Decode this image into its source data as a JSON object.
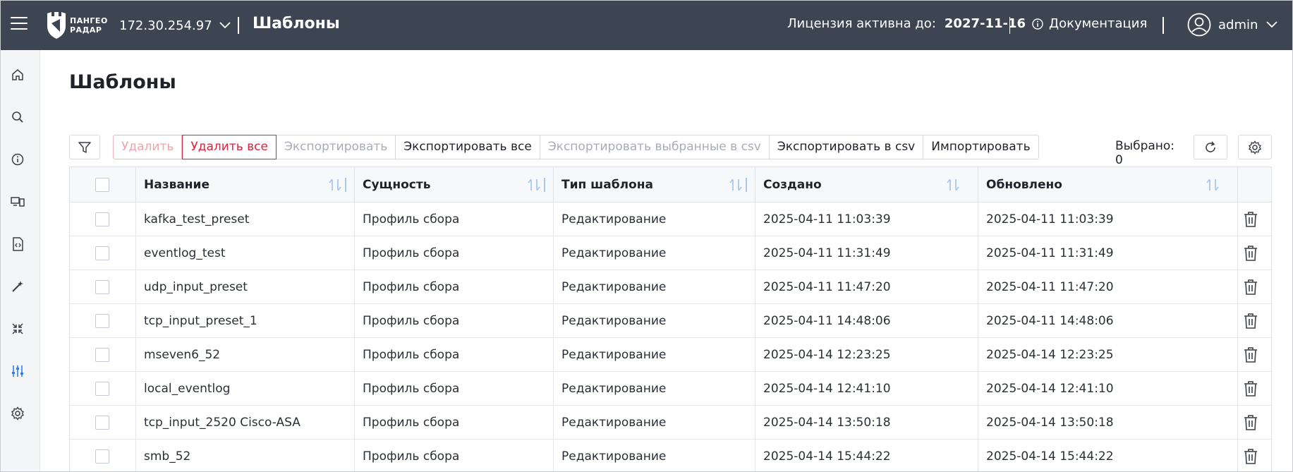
{
  "header": {
    "logo_line1": "ПАНГЕО",
    "logo_line2": "РАДАР",
    "server_ip": "172.30.254.97",
    "title": "Шаблоны",
    "license_label": "Лицензия активна до:",
    "license_date": "2027-11-16",
    "docs_label": "Документация",
    "username": "admin"
  },
  "sidebar": {
    "items": [
      {
        "icon": "home-icon"
      },
      {
        "icon": "search-icon"
      },
      {
        "icon": "info-icon"
      },
      {
        "icon": "devices-icon"
      },
      {
        "icon": "code-file-icon"
      },
      {
        "icon": "magic-wand-icon"
      },
      {
        "icon": "collapse-icon"
      },
      {
        "icon": "sliders-icon",
        "active": true
      },
      {
        "icon": "gear-icon"
      }
    ],
    "active_color": "#2f80ed"
  },
  "page": {
    "title": "Шаблоны"
  },
  "toolbar": {
    "delete": "Удалить",
    "delete_all": "Удалить все",
    "export": "Экспортировать",
    "export_all": "Экспортировать все",
    "export_selected_csv": "Экспортировать выбранные в csv",
    "export_csv": "Экспортировать в csv",
    "import": "Импортировать",
    "selected": "Выбрано: 0"
  },
  "table": {
    "columns": [
      "Название",
      "Сущность",
      "Тип шаблона",
      "Создано",
      "Обновлено"
    ],
    "rows": [
      {
        "name": "kafka_test_preset",
        "entity": "Профиль сбора",
        "type": "Редактирование",
        "created": "2025-04-11 11:03:39",
        "updated": "2025-04-11 11:03:39"
      },
      {
        "name": "eventlog_test",
        "entity": "Профиль сбора",
        "type": "Редактирование",
        "created": "2025-04-11 11:31:49",
        "updated": "2025-04-11 11:31:49"
      },
      {
        "name": "udp_input_preset",
        "entity": "Профиль сбора",
        "type": "Редактирование",
        "created": "2025-04-11 11:47:20",
        "updated": "2025-04-11 11:47:20"
      },
      {
        "name": "tcp_input_preset_1",
        "entity": "Профиль сбора",
        "type": "Редактирование",
        "created": "2025-04-11 14:48:06",
        "updated": "2025-04-11 14:48:06"
      },
      {
        "name": "mseven6_52",
        "entity": "Профиль сбора",
        "type": "Редактирование",
        "created": "2025-04-14 12:23:25",
        "updated": "2025-04-14 12:23:25"
      },
      {
        "name": "local_eventlog",
        "entity": "Профиль сбора",
        "type": "Редактирование",
        "created": "2025-04-14 12:41:10",
        "updated": "2025-04-14 12:41:10"
      },
      {
        "name": "tcp_input_2520 Cisco-ASA",
        "entity": "Профиль сбора",
        "type": "Редактирование",
        "created": "2025-04-14 13:50:18",
        "updated": "2025-04-14 13:50:18"
      },
      {
        "name": "smb_52",
        "entity": "Профиль сбора",
        "type": "Редактирование",
        "created": "2025-04-14 15:44:22",
        "updated": "2025-04-14 15:44:22"
      }
    ]
  },
  "colors": {
    "header_bg": "#3d4553",
    "danger": "#d7263d",
    "sort_icon": "#a9c9ec"
  }
}
